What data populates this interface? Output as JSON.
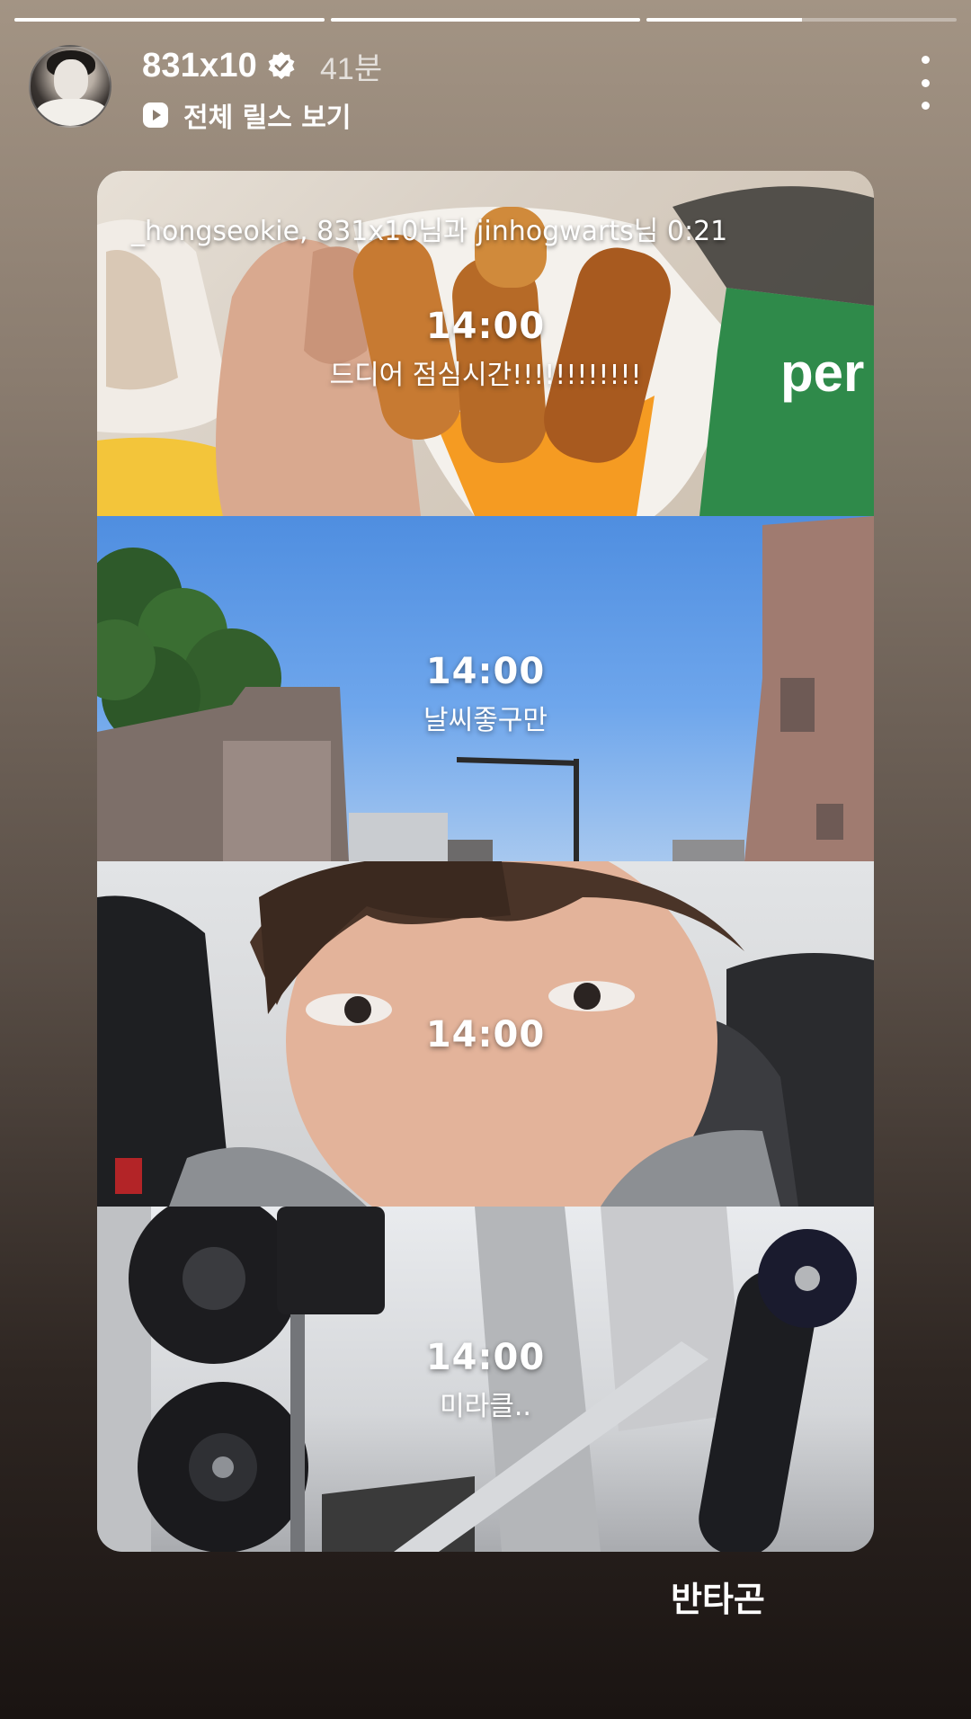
{
  "story": {
    "progress": [
      {
        "fraction": 1.0
      },
      {
        "fraction": 1.0
      },
      {
        "fraction": 0.5
      }
    ]
  },
  "header": {
    "username": "831x10",
    "verified": true,
    "time_ago": "41분",
    "reels_link_label": "전체 릴스 보기",
    "reels_icon": "play-square-icon",
    "more_icon": "more-vertical-icon"
  },
  "collage": {
    "tagline": "_hongseokie, 831x10님과 jinhogwarts님 0:21",
    "panels": [
      {
        "time": "14:00",
        "caption": "드디어 점심시간!!!!!!!!!!!!"
      },
      {
        "time": "14:00",
        "caption": "날씨좋구만"
      },
      {
        "time": "14:00",
        "caption": ""
      },
      {
        "time": "14:00",
        "caption": "미라클.."
      }
    ]
  },
  "footer": {
    "caption": "반타곤"
  },
  "colors": {
    "background_top": "#a39484",
    "background_bottom": "#1a1412",
    "accent_white": "#ffffff"
  }
}
